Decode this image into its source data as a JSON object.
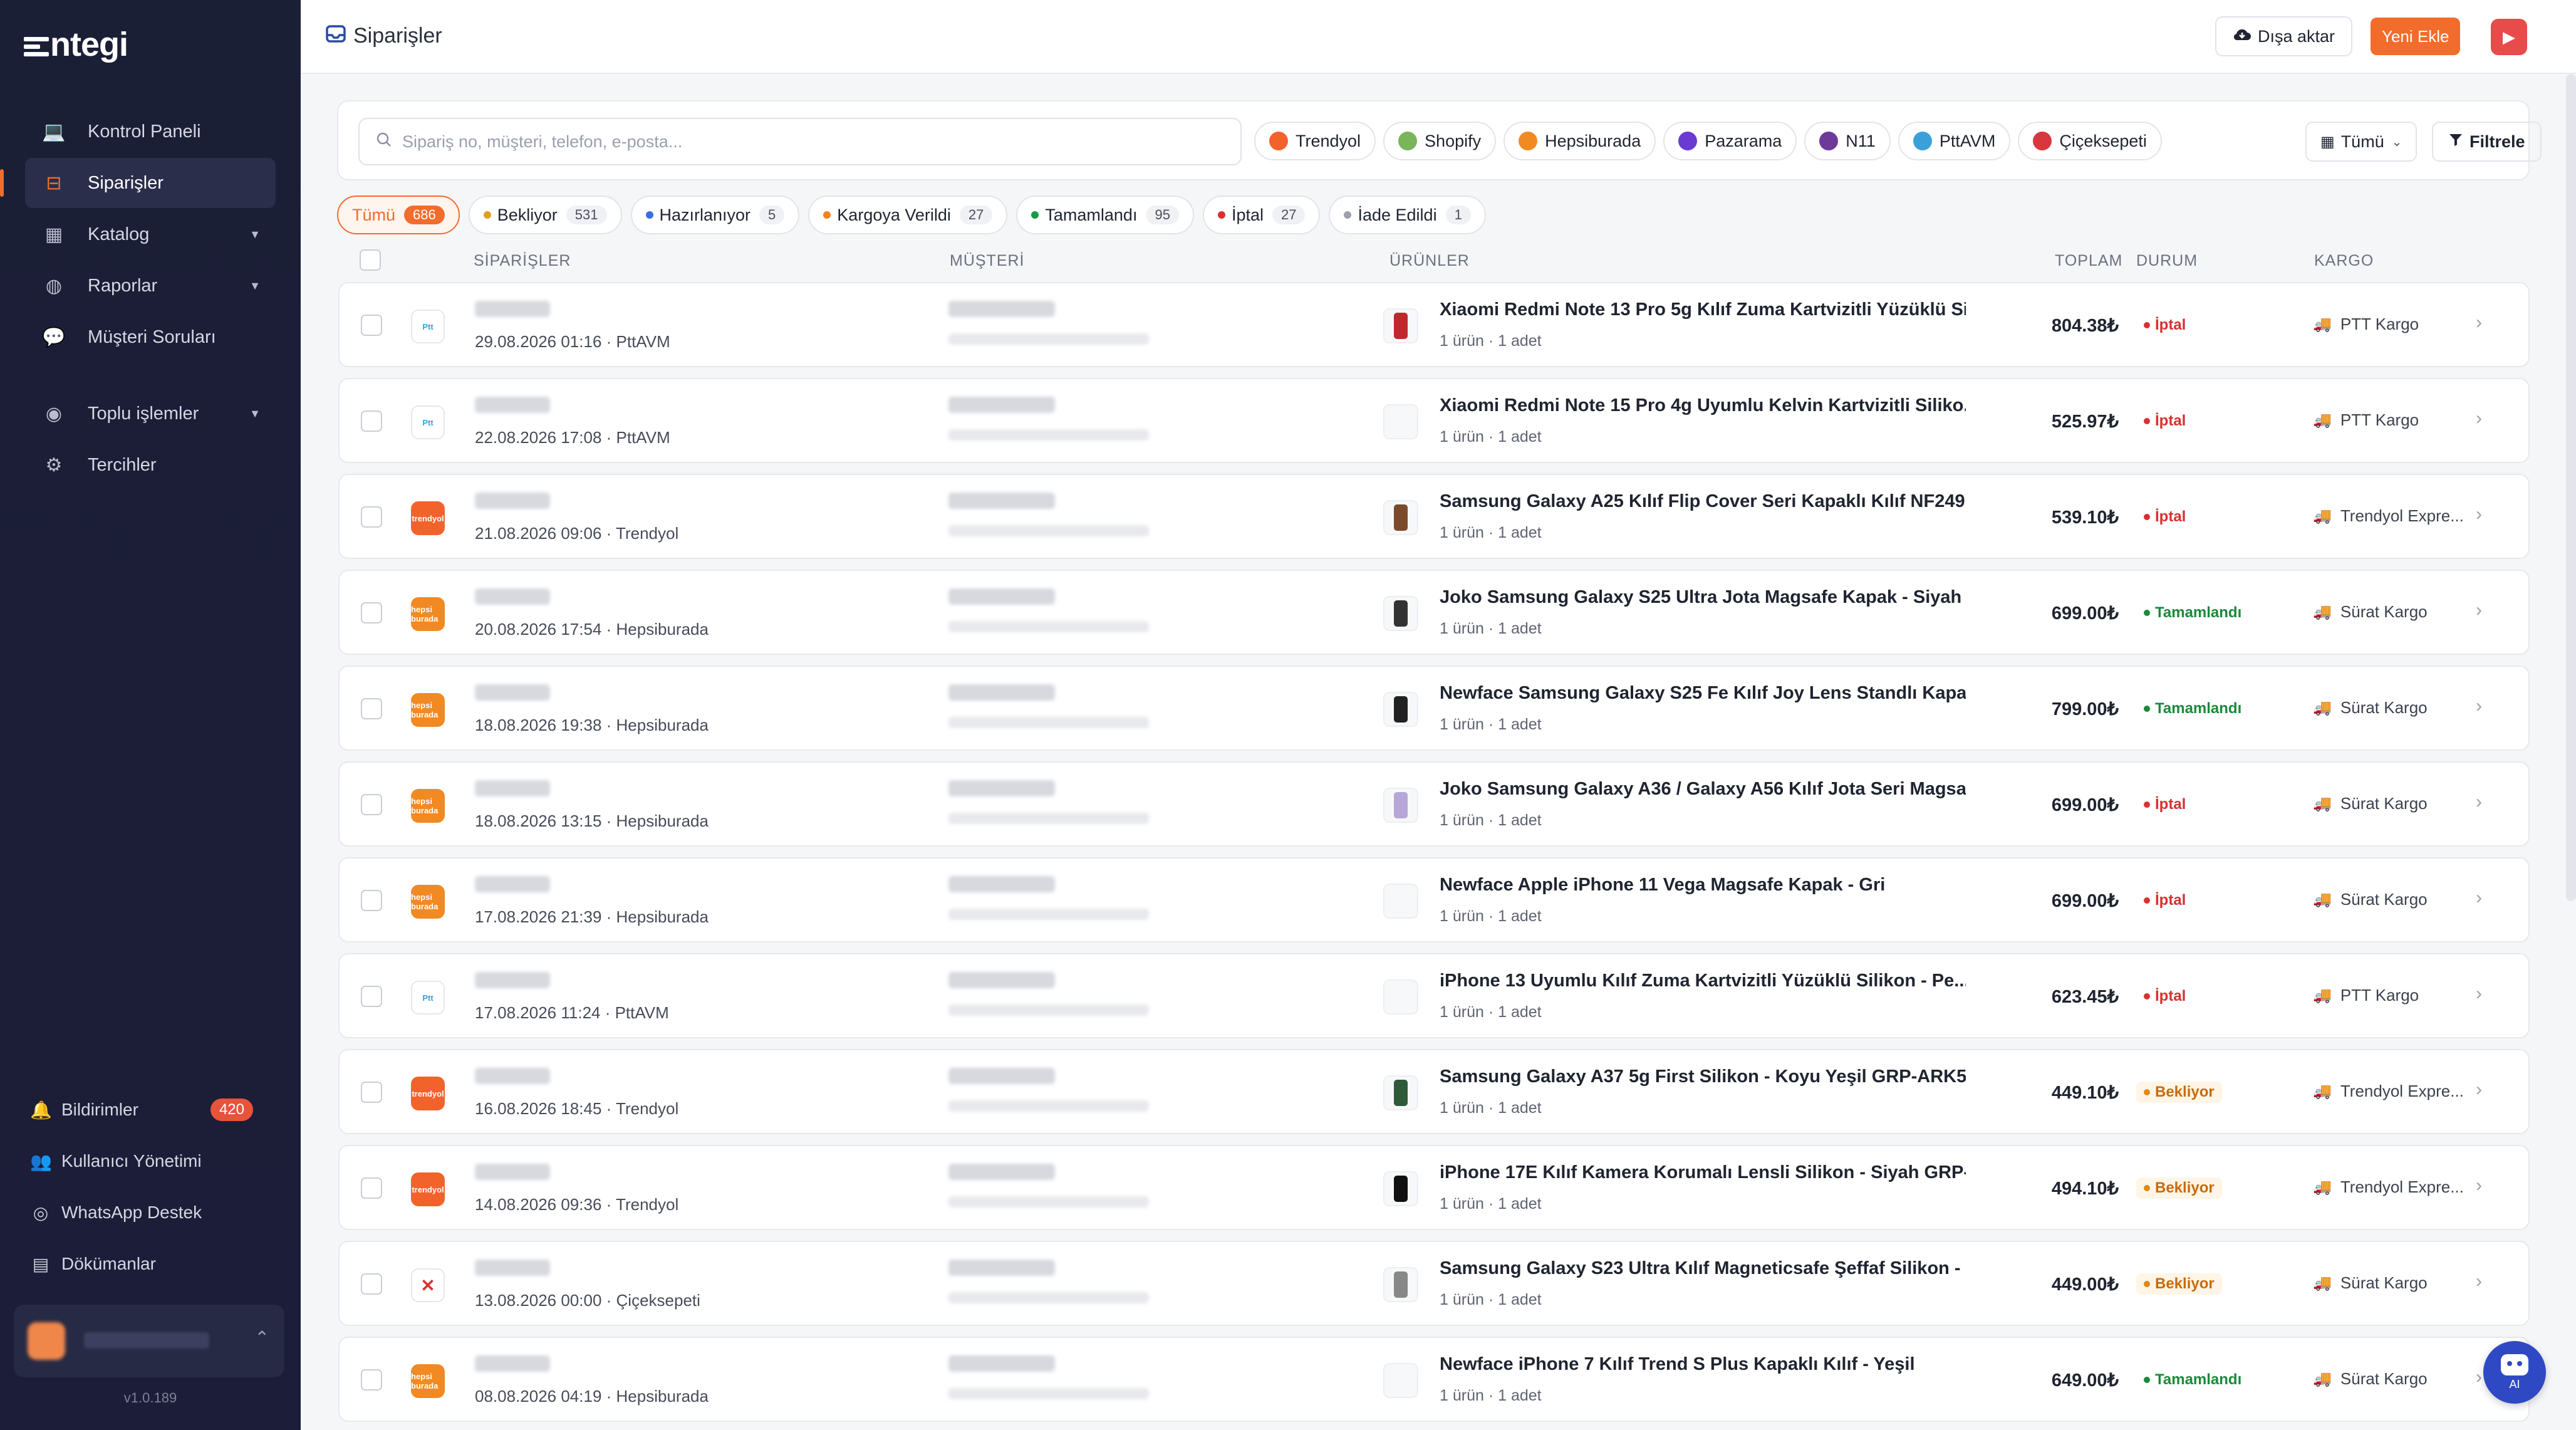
{
  "app": {
    "logo": "ntegi",
    "version": "v1.0.189"
  },
  "sidebar": {
    "items": [
      {
        "label": "Kontrol Paneli",
        "icon": "laptop-icon"
      },
      {
        "label": "Siparişler",
        "icon": "inbox-icon",
        "active": true
      },
      {
        "label": "Katalog",
        "icon": "grid-icon",
        "caret": true
      },
      {
        "label": "Raporlar",
        "icon": "globe-icon",
        "caret": true
      },
      {
        "label": "Müşteri Soruları",
        "icon": "chat-icon"
      },
      {
        "label": "Toplu işlemler",
        "icon": "flame-icon",
        "caret": true
      },
      {
        "label": "Tercihler",
        "icon": "gear-icon"
      }
    ],
    "bottom": [
      {
        "label": "Bildirimler",
        "icon": "bell-icon",
        "badge": "420"
      },
      {
        "label": "Kullanıcı Yönetimi",
        "icon": "users-icon"
      },
      {
        "label": "WhatsApp Destek",
        "icon": "whatsapp-icon"
      },
      {
        "label": "Dökümanlar",
        "icon": "book-icon"
      }
    ]
  },
  "header": {
    "title": "Siparişler",
    "export_label": "Dışa aktar",
    "new_label": "Yeni Ekle"
  },
  "filters": {
    "search_placeholder": "Sipariş no, müşteri, telefon, e-posta...",
    "marketplaces": [
      {
        "label": "Trendyol",
        "color": "#f2632c"
      },
      {
        "label": "Shopify",
        "color": "#7ab55c"
      },
      {
        "label": "Hepsiburada",
        "color": "#f18a22"
      },
      {
        "label": "Pazarama",
        "color": "#6a3bd1"
      },
      {
        "label": "N11",
        "color": "#6e3a9a"
      },
      {
        "label": "PttAVM",
        "color": "#3aa1d8"
      },
      {
        "label": "Çiçeksepeti",
        "color": "#d9363e"
      }
    ],
    "date_select": "Tümü",
    "filter_label": "Filtrele"
  },
  "status_tabs": [
    {
      "label": "Tümü",
      "count": "686",
      "active": true
    },
    {
      "label": "Bekliyor",
      "count": "531",
      "color": "#e0a020"
    },
    {
      "label": "Hazırlanıyor",
      "count": "5",
      "color": "#3b6fe0"
    },
    {
      "label": "Kargoya Verildi",
      "count": "27",
      "color": "#f0831e"
    },
    {
      "label": "Tamamlandı",
      "count": "95",
      "color": "#1a9a45"
    },
    {
      "label": "İptal",
      "count": "27",
      "color": "#d93030"
    },
    {
      "label": "İade Edildi",
      "count": "1",
      "color": "#9ca0ab"
    }
  ],
  "columns": {
    "orders": "SİPARİŞLER",
    "customer": "MÜŞTERİ",
    "products": "ÜRÜNLER",
    "total": "TOPLAM",
    "status": "DURUM",
    "cargo": "KARGO"
  },
  "orders": [
    {
      "date": "29.08.2026 01:16 · PttAVM",
      "mp": "ptt",
      "product": "Xiaomi Redmi Note 13 Pro 5g Kılıf Zuma Kartvizitli Yüzüklü Si...",
      "meta": "1 ürün · 1 adet",
      "total": "804.38₺",
      "status": "İptal",
      "st": "iptal",
      "cargo": "PTT Kargo",
      "thumb": "#c0282d"
    },
    {
      "date": "22.08.2026 17:08 · PttAVM",
      "mp": "ptt",
      "product": "Xiaomi Redmi Note 15 Pro 4g Uyumlu Kelvin Kartvizitli Siliko...",
      "meta": "1 ürün · 1 adet",
      "total": "525.97₺",
      "status": "İptal",
      "st": "iptal",
      "cargo": "PTT Kargo",
      "thumb": ""
    },
    {
      "date": "21.08.2026 09:06 · Trendyol",
      "mp": "ty",
      "product": "Samsung Galaxy A25 Kılıf Flip Cover Seri Kapaklı Kılıf NF249...",
      "meta": "1 ürün · 1 adet",
      "total": "539.10₺",
      "status": "İptal",
      "st": "iptal",
      "cargo": "Trendyol Expre...",
      "thumb": "#7a4a2a"
    },
    {
      "date": "20.08.2026 17:54 · Hepsiburada",
      "mp": "hb",
      "product": "Joko Samsung Galaxy S25 Ultra Jota Magsafe Kapak - Siyah",
      "meta": "1 ürün · 1 adet",
      "total": "699.00₺",
      "status": "Tamamlandı",
      "st": "tam",
      "cargo": "Sürat Kargo",
      "thumb": "#333"
    },
    {
      "date": "18.08.2026 19:38 · Hepsiburada",
      "mp": "hb",
      "product": "Newface Samsung Galaxy S25 Fe Kılıf Joy Lens Standlı Kapak...",
      "meta": "1 ürün · 1 adet",
      "total": "799.00₺",
      "status": "Tamamlandı",
      "st": "tam",
      "cargo": "Sürat Kargo",
      "thumb": "#222"
    },
    {
      "date": "18.08.2026 13:15 · Hepsiburada",
      "mp": "hb",
      "product": "Joko Samsung Galaxy A36 / Galaxy A56 Kılıf Jota Seri Magsaf...",
      "meta": "1 ürün · 1 adet",
      "total": "699.00₺",
      "status": "İptal",
      "st": "iptal",
      "cargo": "Sürat Kargo",
      "thumb": "#b7a6d8"
    },
    {
      "date": "17.08.2026 21:39 · Hepsiburada",
      "mp": "hb",
      "product": "Newface Apple iPhone 11 Vega Magsafe Kapak - Gri",
      "meta": "1 ürün · 1 adet",
      "total": "699.00₺",
      "status": "İptal",
      "st": "iptal",
      "cargo": "Sürat Kargo",
      "thumb": ""
    },
    {
      "date": "17.08.2026 11:24 · PttAVM",
      "mp": "ptt",
      "product": "iPhone 13 Uyumlu Kılıf Zuma Kartvizitli Yüzüklü Silikon - Pe...",
      "meta": "1 ürün · 1 adet",
      "total": "623.45₺",
      "status": "İptal",
      "st": "iptal",
      "cargo": "PTT Kargo",
      "thumb": ""
    },
    {
      "date": "16.08.2026 18:45 · Trendyol",
      "mp": "ty",
      "product": "Samsung Galaxy A37 5g First Silikon - Koyu Yeşil GRP-ARK5...",
      "meta": "1 ürün · 1 adet",
      "total": "449.10₺",
      "status": "Bekliyor",
      "st": "bek",
      "cargo": "Trendyol Expre...",
      "thumb": "#2e5a3a"
    },
    {
      "date": "14.08.2026 09:36 · Trendyol",
      "mp": "ty",
      "product": "iPhone 17E Kılıf Kamera Korumalı Lensli Silikon - Siyah GRP-...",
      "meta": "1 ürün · 1 adet",
      "total": "494.10₺",
      "status": "Bekliyor",
      "st": "bek",
      "cargo": "Trendyol Expre...",
      "thumb": "#111"
    },
    {
      "date": "13.08.2026 00:00 · Çiçeksepeti",
      "mp": "cs",
      "product": "Samsung Galaxy S23 Ultra Kılıf Magneticsafe Şeffaf Silikon - ...",
      "meta": "1 ürün · 1 adet",
      "total": "449.00₺",
      "status": "Bekliyor",
      "st": "bek",
      "cargo": "Sürat Kargo",
      "thumb": "#888"
    },
    {
      "date": "08.08.2026 04:19 · Hepsiburada",
      "mp": "hb",
      "product": "Newface iPhone 7 Kılıf Trend S Plus Kapaklı Kılıf - Yeşil",
      "meta": "1 ürün · 1 adet",
      "total": "649.00₺",
      "status": "Tamamlandı",
      "st": "tam",
      "cargo": "Sürat Kargo",
      "thumb": ""
    }
  ],
  "ai_button_label": "AI"
}
